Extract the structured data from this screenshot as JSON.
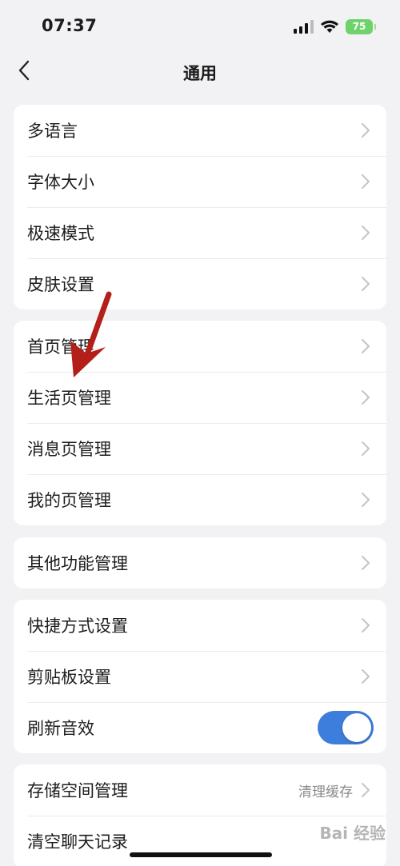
{
  "status_bar": {
    "time": "07:37",
    "battery": "75"
  },
  "nav": {
    "title": "通用"
  },
  "groups": [
    {
      "items": [
        {
          "label": "多语言"
        },
        {
          "label": "字体大小"
        },
        {
          "label": "极速模式"
        },
        {
          "label": "皮肤设置"
        }
      ]
    },
    {
      "items": [
        {
          "label": "首页管理"
        },
        {
          "label": "生活页管理"
        },
        {
          "label": "消息页管理"
        },
        {
          "label": "我的页管理"
        }
      ]
    },
    {
      "items": [
        {
          "label": "其他功能管理"
        }
      ]
    },
    {
      "items": [
        {
          "label": "快捷方式设置"
        },
        {
          "label": "剪贴板设置"
        },
        {
          "label": "刷新音效",
          "toggle_on": true
        }
      ]
    },
    {
      "items": [
        {
          "label": "存储空间管理",
          "value": "清理缓存"
        },
        {
          "label": "清空聊天记录"
        }
      ]
    }
  ],
  "colors": {
    "toggle_on": "#3d7ddb",
    "annotation_arrow": "#b3201a",
    "background": "#f2f2f4"
  },
  "watermark": {
    "text": "Bai 经验"
  }
}
